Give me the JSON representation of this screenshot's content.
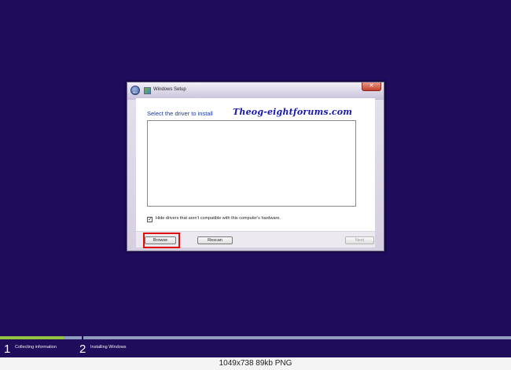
{
  "dialog": {
    "title": "Windows Setup",
    "close_label": "✕",
    "heading": "Select the driver to install",
    "watermark": "Theog-eightforums.com",
    "hide_incompatible": {
      "label": "Hide drivers that aren't compatible with this computer's hardware.",
      "checked": true
    },
    "buttons": {
      "browse": "Browse",
      "rescan": "Rescan",
      "next": "Next"
    }
  },
  "progress": {
    "fill_fraction": 0.125,
    "steps": [
      {
        "number": "1",
        "label": "Collecting information"
      },
      {
        "number": "2",
        "label": "Installing Windows"
      }
    ]
  },
  "caption": "1049x738  89kb  PNG",
  "colors": {
    "background": "#1f0c5a",
    "progress_fill": "#94c341",
    "highlight": "#e01010"
  }
}
